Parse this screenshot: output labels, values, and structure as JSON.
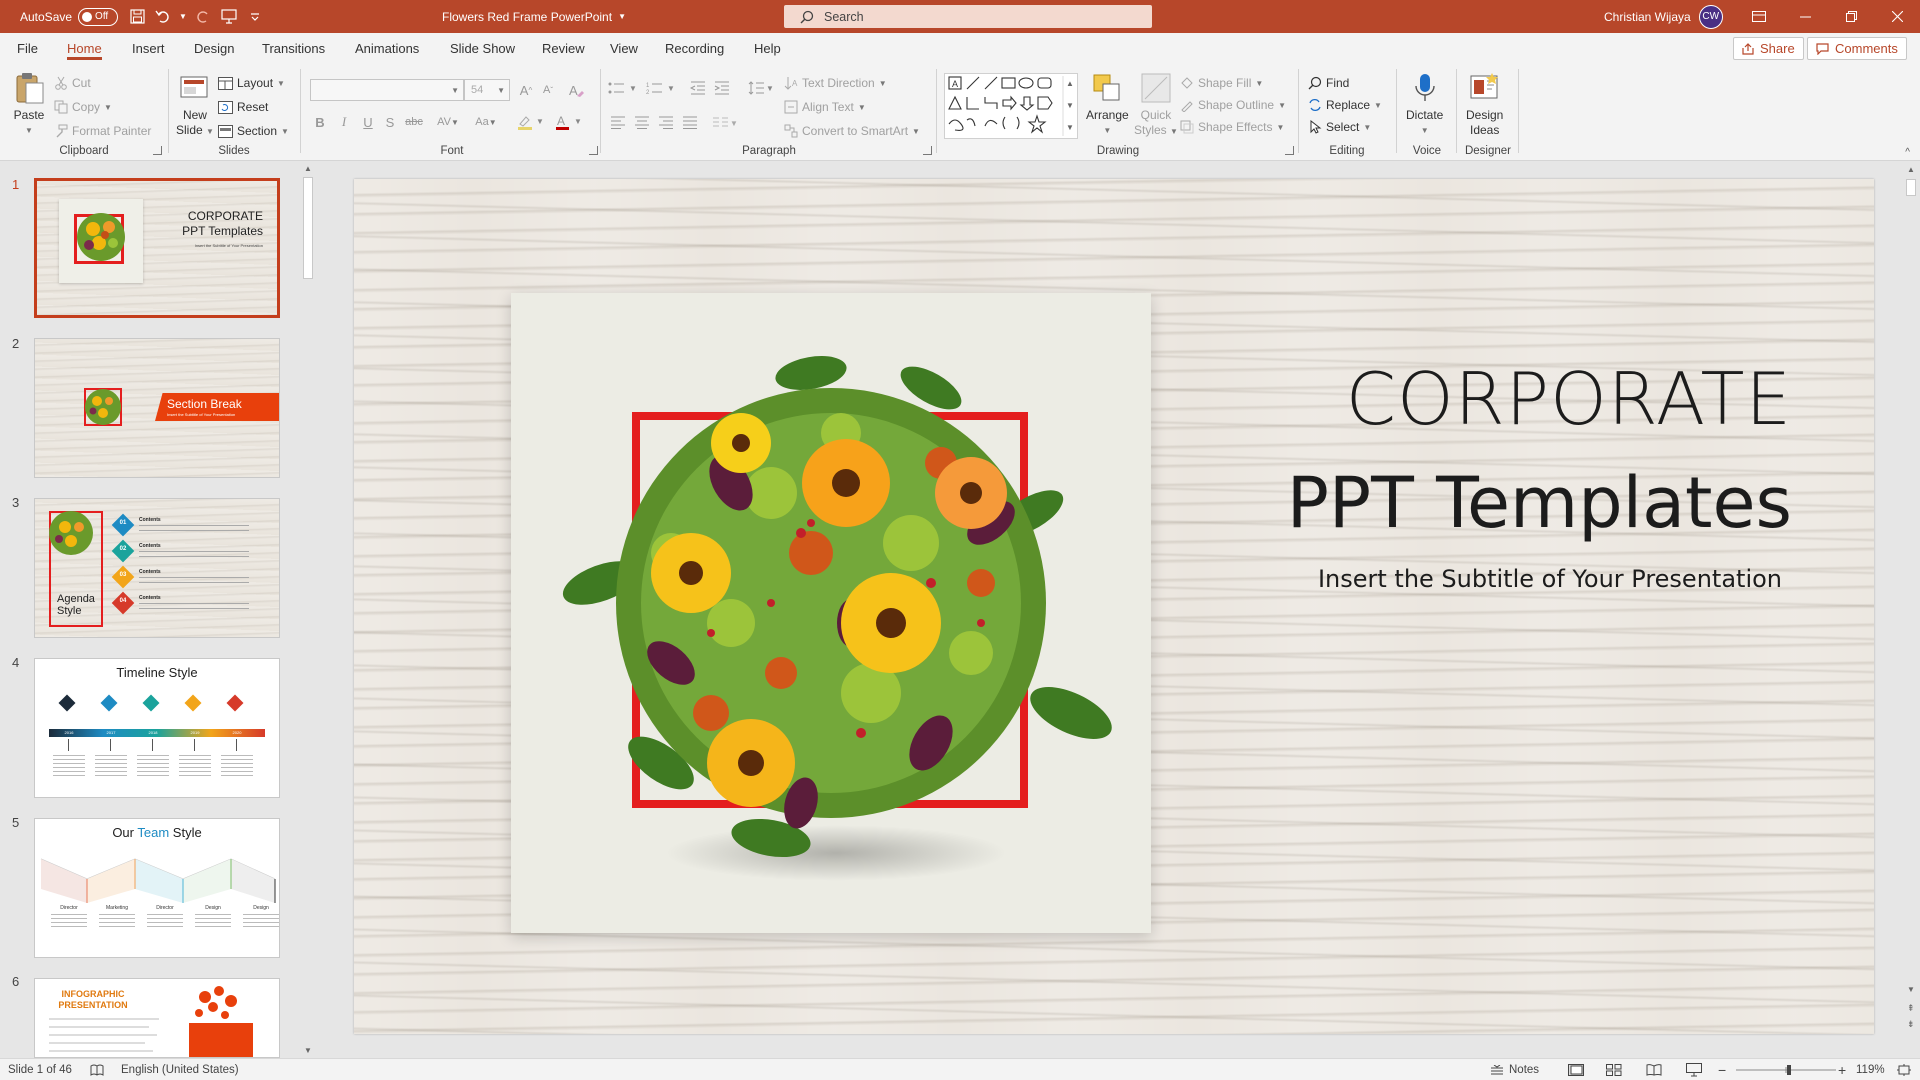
{
  "titlebar": {
    "autosave_label": "AutoSave",
    "autosave_state": "Off",
    "document_title": "Flowers Red Frame PowerPoint",
    "search_placeholder": "Search",
    "user_name": "Christian Wijaya",
    "user_initials": "CW",
    "accent_color": "#b7472a"
  },
  "tabs": {
    "file": "File",
    "home": "Home",
    "insert": "Insert",
    "design": "Design",
    "transitions": "Transitions",
    "animations": "Animations",
    "slide_show": "Slide Show",
    "review": "Review",
    "view": "View",
    "recording": "Recording",
    "help": "Help",
    "share": "Share",
    "comments": "Comments"
  },
  "ribbon": {
    "clipboard": {
      "label": "Clipboard",
      "paste": "Paste",
      "cut": "Cut",
      "copy": "Copy",
      "format_painter": "Format Painter"
    },
    "slides": {
      "label": "Slides",
      "new_slide_1": "New",
      "new_slide_2": "Slide",
      "layout": "Layout",
      "reset": "Reset",
      "section": "Section"
    },
    "font": {
      "label": "Font",
      "font_name": "",
      "font_size": "54"
    },
    "paragraph": {
      "label": "Paragraph",
      "text_direction": "Text Direction",
      "align_text": "Align Text",
      "convert_smartart": "Convert to SmartArt"
    },
    "drawing": {
      "label": "Drawing",
      "arrange": "Arrange",
      "quick_styles_1": "Quick",
      "quick_styles_2": "Styles",
      "shape_fill": "Shape Fill",
      "shape_outline": "Shape Outline",
      "shape_effects": "Shape Effects"
    },
    "editing": {
      "label": "Editing",
      "find": "Find",
      "replace": "Replace",
      "select": "Select"
    },
    "voice": {
      "label": "Voice",
      "dictate": "Dictate"
    },
    "designer": {
      "label": "Designer",
      "design_ideas_1": "Design",
      "design_ideas_2": "Ideas"
    }
  },
  "thumbnails": [
    {
      "num": "1",
      "title_1": "CORPORATE",
      "title_2": "PPT Templates",
      "subtitle": "Insert the Subtitle of Your Presentation"
    },
    {
      "num": "2",
      "banner": "Section Break",
      "banner_sub": "Insert the Subtitle of Your Presentation"
    },
    {
      "num": "3",
      "label": "Agenda Style",
      "items": [
        "01",
        "02",
        "03",
        "04"
      ],
      "item_title": "Contents"
    },
    {
      "num": "4",
      "title": "Timeline Style",
      "years": [
        "2016",
        "2017",
        "2018",
        "2019",
        "2020"
      ]
    },
    {
      "num": "5",
      "title_1": "Our ",
      "title_accent": "Team",
      "title_2": " Style",
      "roles": [
        "Director",
        "Marketing",
        "Director",
        "Design",
        "Design"
      ]
    },
    {
      "num": "6",
      "title": "INFOGRAPHIC PRESENTATION"
    }
  ],
  "slide": {
    "title_line1": "CORPORATE",
    "title_line2": "PPT Templates",
    "subtitle": "Insert the Subtitle of Your Presentation",
    "frame_color": "#e41e1e"
  },
  "status": {
    "slide_info": "Slide 1 of 46",
    "language": "English (United States)",
    "notes": "Notes",
    "zoom": "119%"
  }
}
